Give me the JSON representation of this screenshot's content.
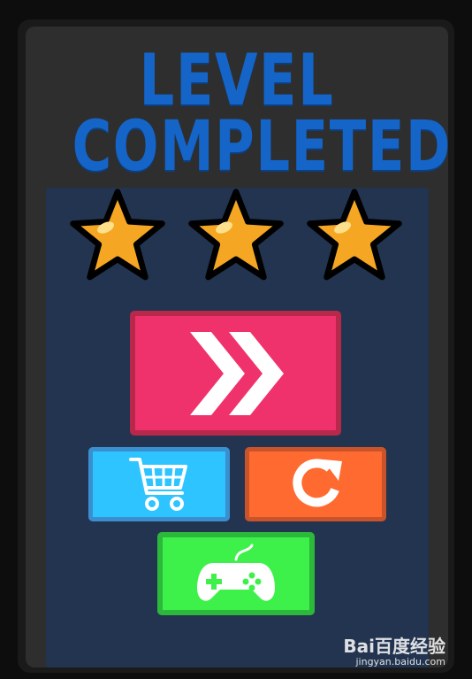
{
  "title": {
    "line1": "LEVEL",
    "line2": "COMPLETED"
  },
  "stars": {
    "earned": 3,
    "total": 3
  },
  "buttons": {
    "next": "chevrons-right-icon",
    "shop": "shopping-cart-icon",
    "restart": "restart-icon",
    "play": "gamepad-icon"
  },
  "colors": {
    "title": "#1565c8",
    "next": "#f0326c",
    "shop": "#2ec4ff",
    "restart": "#ff6a30",
    "play": "#3ef04a",
    "star": "#f5a623"
  },
  "watermark": {
    "brand": "Bai百度经验",
    "url": "jingyan.baidu.com"
  }
}
